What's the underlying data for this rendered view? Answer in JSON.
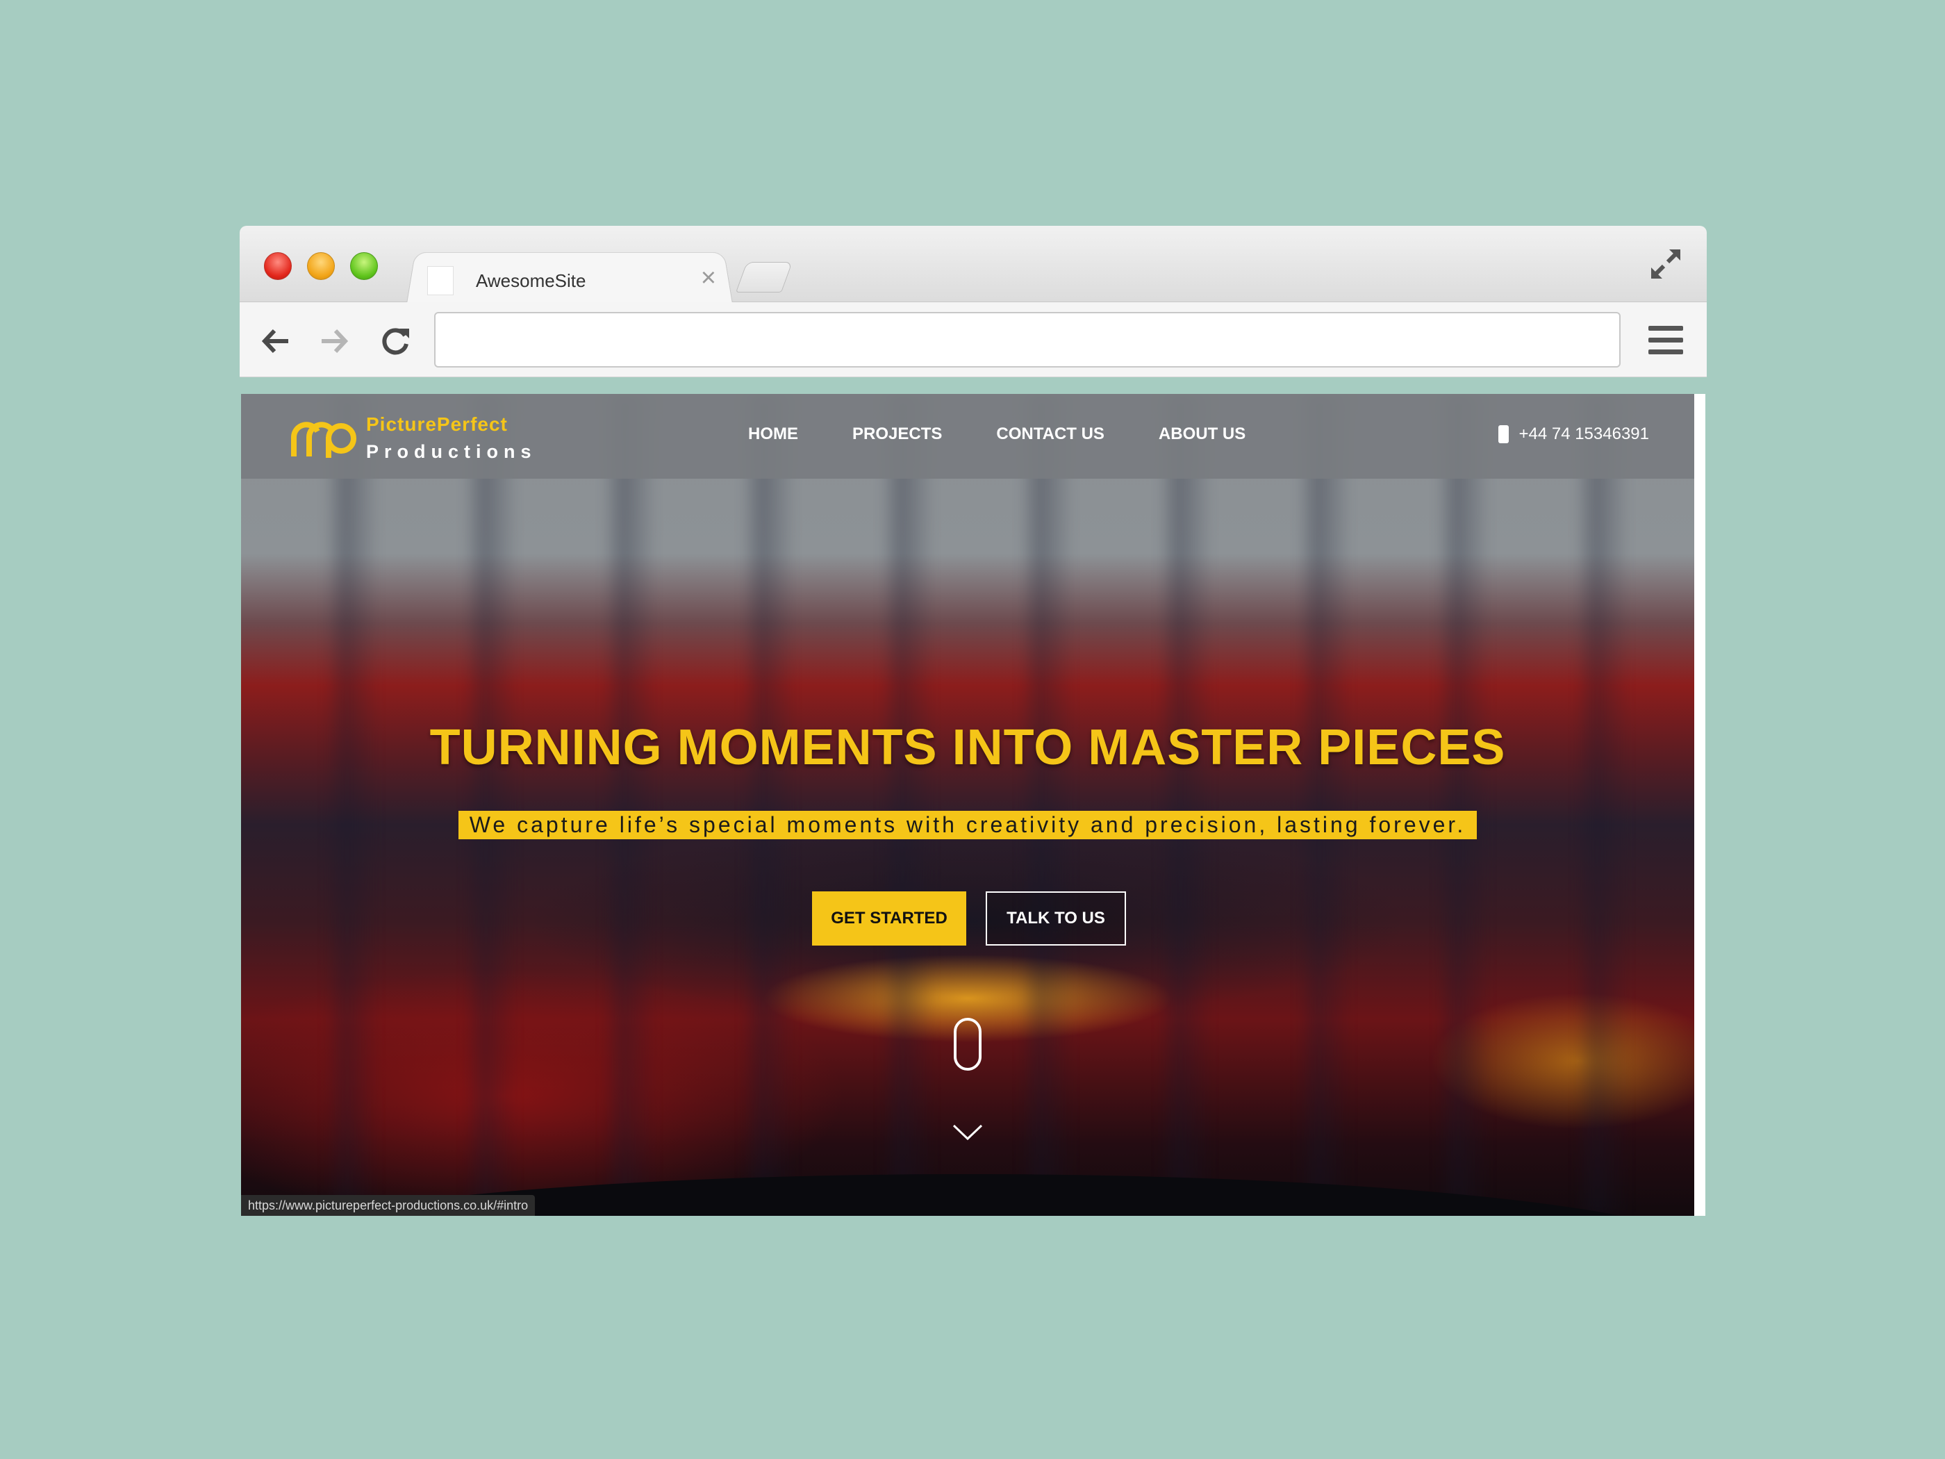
{
  "browser": {
    "tab_title": "AwesomeSite",
    "tab_close": "×",
    "address_value": ""
  },
  "site": {
    "logo": {
      "line1": "PicturePerfect",
      "line2": "Productions"
    },
    "nav": {
      "items": [
        {
          "label": "HOME"
        },
        {
          "label": "PROJECTS"
        },
        {
          "label": "CONTACT US"
        },
        {
          "label": "ABOUT US"
        }
      ]
    },
    "phone": "+44 74 15346391",
    "hero": {
      "title": "TURNING MOMENTS INTO MASTER PIECES",
      "subtitle": "We capture life’s special moments with creativity and precision, lasting forever.",
      "primary_button": "GET STARTED",
      "secondary_button": "TALK TO US"
    },
    "status_url": "https://www.pictureperfect-productions.co.uk/#intro"
  },
  "colors": {
    "background": "#a6ccc1",
    "accent": "#f5c518",
    "navbar": "#787c80"
  },
  "icons": {
    "back": "back-arrow-icon",
    "forward": "forward-arrow-icon",
    "reload": "reload-icon",
    "menu": "hamburger-menu-icon",
    "fullscreen": "fullscreen-icon",
    "phone": "phone-icon",
    "scroll": "mouse-scroll-icon",
    "down": "chevron-down-icon"
  }
}
